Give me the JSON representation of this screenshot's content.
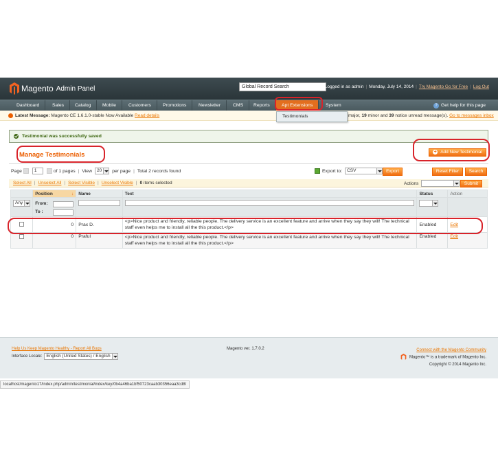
{
  "header": {
    "logo_text": "Magento",
    "logo_sub": "Admin Panel",
    "search_value": "Global Record Search",
    "logged_in": "Logged in as admin",
    "date": "Monday, July 14, 2014",
    "try_link": "Try Magento Go for Free",
    "logout": "Log Out"
  },
  "nav": {
    "items": [
      "Dashboard",
      "Sales",
      "Catalog",
      "Mobile",
      "Customers",
      "Promotions",
      "Newsletter",
      "CMS",
      "Reports",
      "Apt Extensions",
      "System"
    ],
    "help": "Get help for this page",
    "dropdown_item": "Testimonials"
  },
  "notice": {
    "label": "Latest Message:",
    "text": "Magento CE 1.6.1.0-stable Now Available",
    "link": "Read details",
    "right_text_a": "major, ",
    "right_num1": "19",
    "right_text_b": " minor and ",
    "right_num2": "39",
    "right_text_c": " notice unread message(s).",
    "right_link": "Go to messages inbox"
  },
  "success_message": "Testimonial was successfully saved",
  "page_title": "Manage Testimonials",
  "add_button": "Add New Testimonial",
  "pager": {
    "page_label": "Page",
    "page_value": "1",
    "of_pages": "of 1 pages",
    "view_label": "View",
    "view_value": "20",
    "per_page": "per page",
    "total": "Total 2 records found"
  },
  "export": {
    "label": "Export to:",
    "format": "CSV",
    "button": "Export",
    "reset": "Reset Filter",
    "search": "Search"
  },
  "massaction": {
    "select_all": "Select All",
    "unselect_all": "Unselect All",
    "select_visible": "Select Visible",
    "unselect_visible": "Unselect Visible",
    "selected_count": "0",
    "selected_label": "items selected",
    "actions_label": "Actions",
    "submit": "Submit"
  },
  "grid": {
    "columns": [
      "Position",
      "Name",
      "Text",
      "Status",
      "Action"
    ],
    "filter_any": "Any",
    "from": "From:",
    "to": "To :",
    "rows": [
      {
        "position": "0",
        "name": "Prax D.",
        "text": "<p>Nice product and friendly, reliable people. The delivery service is an excellent feature and arrive when they say they will! The technical staff even helps me to install all the this product.</p>",
        "status": "Enabled",
        "action": "Edit"
      },
      {
        "position": "0",
        "name": "Praful",
        "text": "<p>Nice product and friendly, reliable people. The delivery service is an excellent feature and arrive when they say they will! The technical staff even helps me to install all the this product.</p>",
        "status": "Enabled",
        "action": "Edit"
      }
    ]
  },
  "footer": {
    "bug_link": "Help Us Keep Magento Healthy - Report All Bugs",
    "locale_label": "Interface Locale:",
    "locale_value": "English (United States) / English",
    "version": "Magento ver. 1.7.0.2",
    "community_link": "Connect with the Magento Community",
    "trademark": "Magento™ is a trademark of Magento Inc.",
    "copyright": "Copyright © 2014 Magento Inc."
  },
  "status_url": "localhost/magento17/index.php/admin/testimonial/index/key/0b4a46ba1bf50723caab30356eaa3cd8/",
  "colors": {
    "accent": "#eb5e00",
    "nav": "#4a5a5f",
    "annotation": "#d8232a"
  }
}
